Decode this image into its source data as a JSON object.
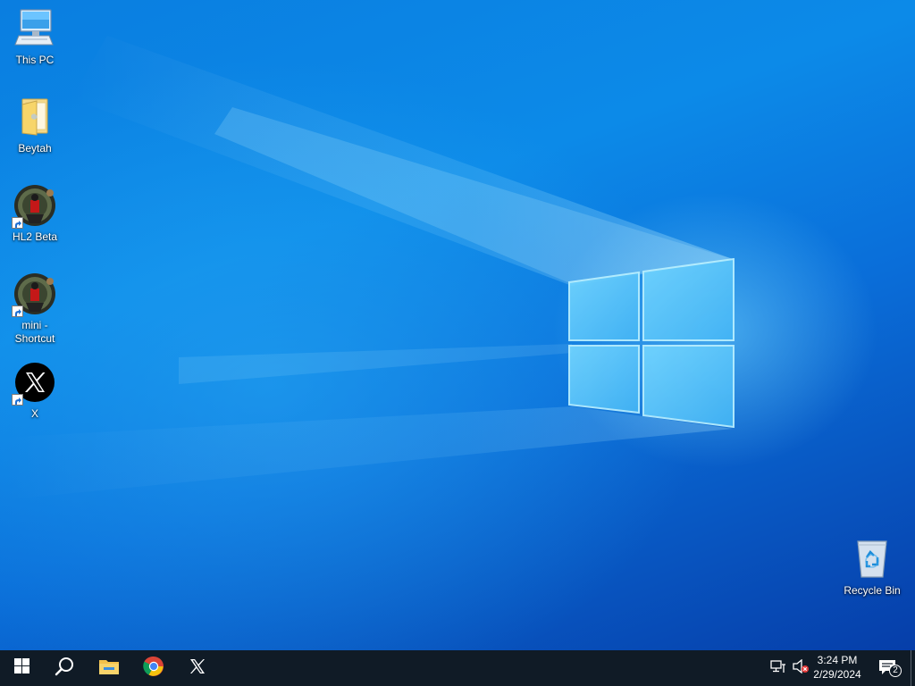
{
  "desktop": {
    "icons": [
      {
        "label": "This PC",
        "icon": "computer-icon",
        "shortcut": false
      },
      {
        "label": "Beytah",
        "icon": "folder-icon",
        "shortcut": false
      },
      {
        "label": "HL2 Beta",
        "icon": "hl2-app-icon",
        "shortcut": true
      },
      {
        "label": "mini - Shortcut",
        "icon": "hl2-app-icon",
        "shortcut": true
      },
      {
        "label": "X",
        "icon": "x-logo-icon",
        "shortcut": true
      },
      {
        "label": "Recycle Bin",
        "icon": "recycle-bin-icon",
        "shortcut": false
      }
    ]
  },
  "taskbar": {
    "start": {
      "icon": "windows-logo-icon"
    },
    "search": {
      "icon": "search-icon"
    },
    "pinned": [
      {
        "name": "File Explorer",
        "icon": "file-explorer-icon"
      },
      {
        "name": "Google Chrome",
        "icon": "chrome-icon"
      },
      {
        "name": "X",
        "icon": "x-logo-icon"
      }
    ],
    "tray": {
      "network_icon": "network-icon",
      "volume_icon": "volume-muted-icon",
      "time": "3:24 PM",
      "date": "2/29/2024",
      "notifications_count": "2",
      "notifications_icon": "action-center-icon"
    }
  },
  "colors": {
    "taskbar": "#101b26",
    "wallpaper_blue": "#0a7ee0",
    "windows_logo_glow": "#8fe0ff"
  }
}
